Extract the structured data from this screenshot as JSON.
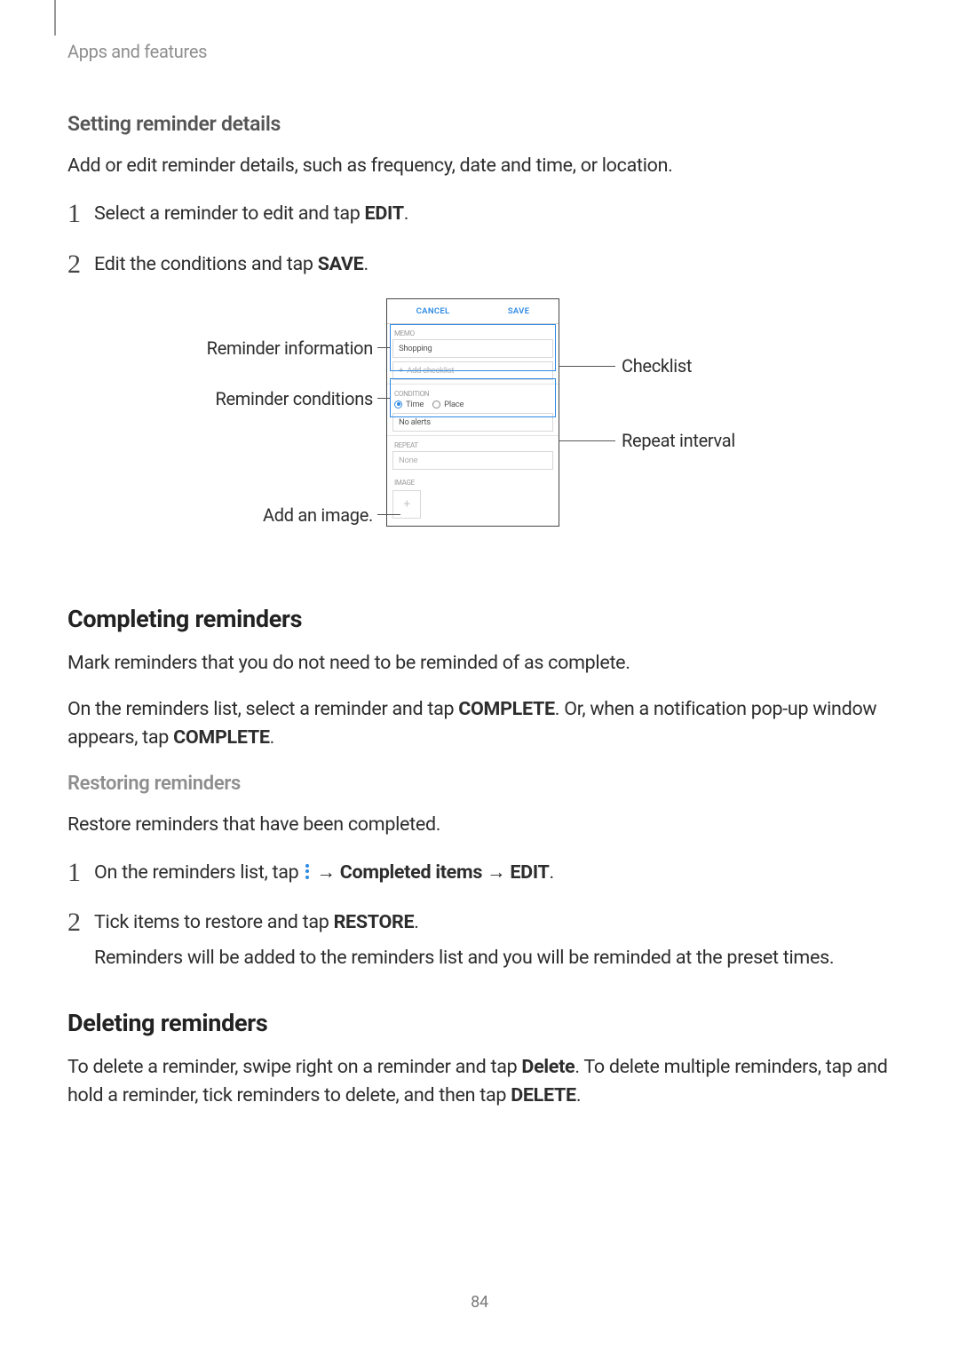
{
  "breadcrumb": "Apps and features",
  "setting_heading": "Setting reminder details",
  "setting_text": "Add or edit reminder details, such as frequency, date and time, or location.",
  "step1_a_pre": "Select a reminder to edit and tap ",
  "step1_a_bold": "EDIT",
  "step1_a_post": ".",
  "step2_a_pre": "Edit the conditions and tap ",
  "step2_a_bold": "SAVE",
  "step2_a_post": ".",
  "figure": {
    "cancel": "CANCEL",
    "save": "SAVE",
    "memo_label": "MEMO",
    "memo_value": "Shopping",
    "add_checklist": "Add checklist",
    "condition_label": "CONDITION",
    "radio_time": "Time",
    "radio_place": "Place",
    "no_alerts": "No alerts",
    "repeat_label": "REPEAT",
    "repeat_value": "None",
    "image_label": "IMAGE",
    "thumb_glyph": "+",
    "callouts": {
      "info": "Reminder information",
      "conditions": "Reminder conditions",
      "add_image": "Add an image.",
      "checklist": "Checklist",
      "repeat": "Repeat interval"
    }
  },
  "completing_heading": "Completing reminders",
  "completing_text1": "Mark reminders that you do not need to be reminded of as complete.",
  "completing_text2_pre": "On the reminders list, select a reminder and tap ",
  "completing_text2_bold1": "COMPLETE",
  "completing_text2_mid": ". Or, when a notification pop-up window appears, tap ",
  "completing_text2_bold2": "COMPLETE",
  "completing_text2_post": ".",
  "restoring_heading": "Restoring reminders",
  "restoring_text": "Restore reminders that have been completed.",
  "restoring_step1_pre": "On the reminders list, tap ",
  "restoring_step1_arrow1": " → ",
  "restoring_step1_bold1": "Completed items",
  "restoring_step1_arrow2": " → ",
  "restoring_step1_bold2": "EDIT",
  "restoring_step1_post": ".",
  "restoring_step2_pre": "Tick items to restore and tap ",
  "restoring_step2_bold": "RESTORE",
  "restoring_step2_post": ".",
  "restoring_step2_body": "Reminders will be added to the reminders list and you will be reminded at the preset times.",
  "deleting_heading": "Deleting reminders",
  "deleting_text_pre": "To delete a reminder, swipe right on a reminder and tap ",
  "deleting_text_bold1": "Delete",
  "deleting_text_mid": ". To delete multiple reminders, tap and hold a reminder, tick reminders to delete, and then tap ",
  "deleting_text_bold2": "DELETE",
  "deleting_text_post": ".",
  "page_number": "84"
}
